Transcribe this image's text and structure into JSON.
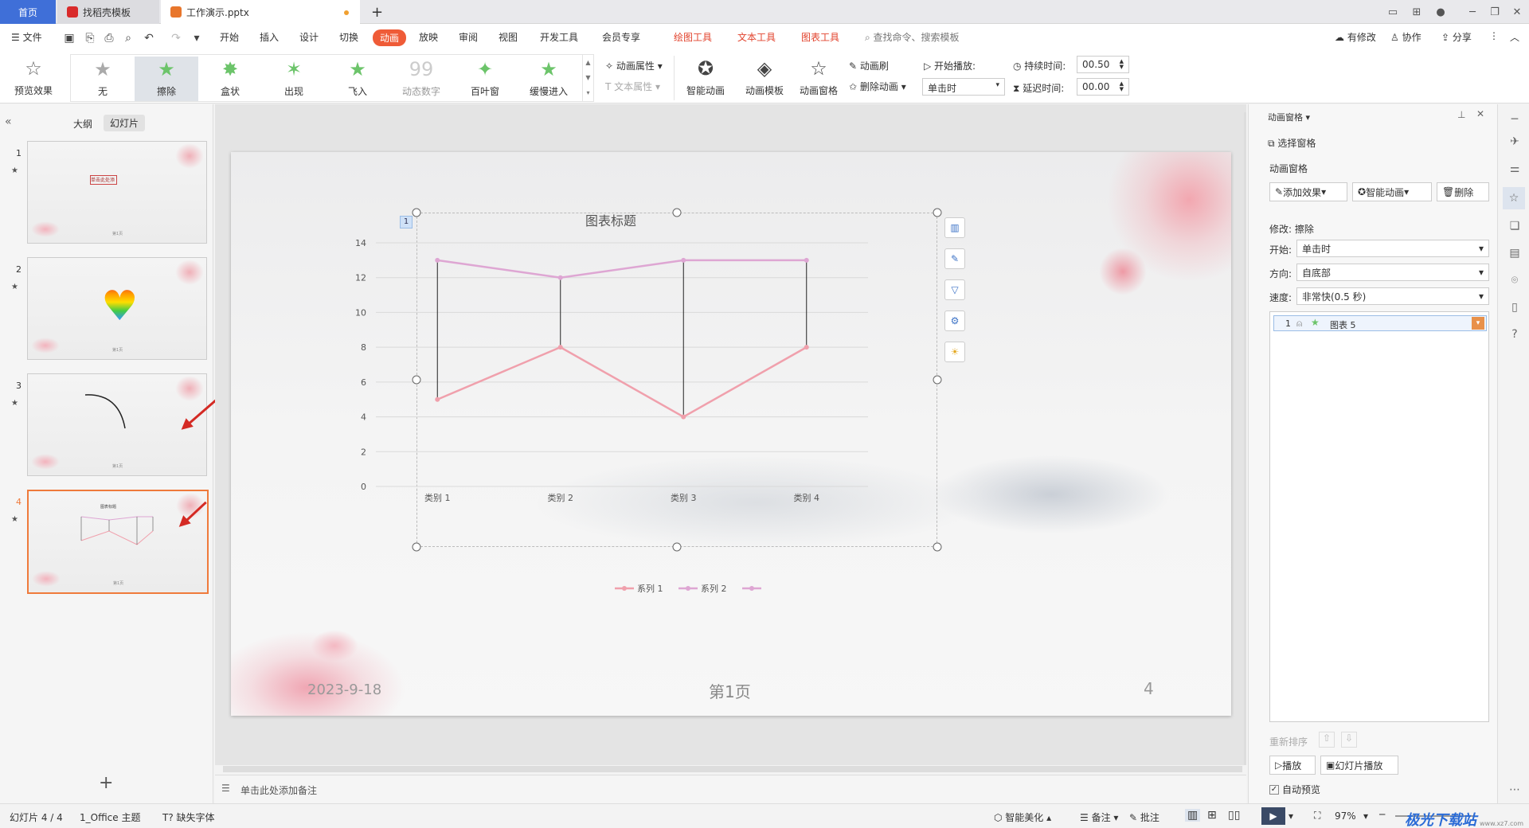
{
  "tabs": {
    "home": "首页",
    "template": "找稻壳模板",
    "doc": "工作演示.pptx",
    "new_tab": "+"
  },
  "menu": {
    "file": "文件",
    "items": [
      "开始",
      "插入",
      "设计",
      "切换",
      "动画",
      "放映",
      "审阅",
      "视图",
      "开发工具",
      "会员专享"
    ],
    "context": [
      "绘图工具",
      "文本工具",
      "图表工具"
    ],
    "search": "查找命令、搜索模板",
    "right": [
      "有修改",
      "协作",
      "分享"
    ]
  },
  "ribbon": {
    "preview": "预览效果",
    "effects": [
      "无",
      "擦除",
      "盒状",
      "出现",
      "飞入",
      "动态数字",
      "百叶窗",
      "缓慢进入"
    ],
    "anim_props": "动画属性",
    "text_props": "文本属性",
    "smart_anim": "智能动画",
    "anim_template": "动画模板",
    "anim_pane": "动画窗格",
    "anim_brush": "动画刷",
    "delete_anim": "删除动画",
    "start_play": "开始播放:",
    "start_value": "单击时",
    "duration_label": "持续时间:",
    "duration_value": "00.50",
    "delay_label": "延迟时间:",
    "delay_value": "00.00"
  },
  "left": {
    "outline": "大纲",
    "slides": "幻灯片",
    "nums": [
      "1",
      "2",
      "3",
      "4"
    ],
    "thumb1_text": "单击此处添加标题",
    "thumb4_title": "图表标题",
    "footer_page": "第1页"
  },
  "chart": {
    "badge": "1",
    "side_icons": [
      "chart-elements-icon",
      "chart-style-icon",
      "chart-filter-icon",
      "settings-icon",
      "bulb-icon"
    ]
  },
  "chart_data": {
    "type": "line",
    "title": "图表标题",
    "categories": [
      "类别 1",
      "类别 2",
      "类别 3",
      "类别 4"
    ],
    "series": [
      {
        "name": "系列 1",
        "values": [
          5,
          8,
          4,
          8
        ],
        "color": "#f0a0ac"
      },
      {
        "name": "系列 2",
        "values": [
          13,
          12,
          13,
          13
        ],
        "color": "#dea6d3"
      },
      {
        "name": "",
        "values": [],
        "color": "#dea6d3"
      }
    ],
    "ylim": [
      0,
      14
    ],
    "yticks": [
      0,
      2,
      4,
      6,
      8,
      10,
      12,
      14
    ],
    "grid": true,
    "legend": "bottom",
    "high_low_lines": true
  },
  "slide": {
    "date": "2023-9-18",
    "page": "第1页",
    "num": "4"
  },
  "notes": "单击此处添加备注",
  "rightpanel": {
    "title": "动画窗格",
    "select_pane": "选择窗格",
    "section": "动画窗格",
    "add_effect": "添加效果",
    "smart_anim": "智能动画",
    "delete": "删除",
    "modify": "修改: 擦除",
    "start_label": "开始:",
    "start_value": "单击时",
    "dir_label": "方向:",
    "dir_value": "自底部",
    "speed_label": "速度:",
    "speed_value": "非常快(0.5 秒)",
    "item_num": "1",
    "item_name": "图表 5",
    "reorder": "重新排序",
    "play": "播放",
    "slideshow": "幻灯片播放",
    "auto_preview": "自动预览"
  },
  "status": {
    "slide": "幻灯片 4 / 4",
    "theme": "1_Office 主题",
    "font": "缺失字体",
    "beautify": "智能美化",
    "notes": "备注",
    "comments": "批注",
    "zoom": "97%",
    "watermark": "极光下载站",
    "watermark_url": "www.xz7.com"
  },
  "colors": {
    "accent": "#ef5b37",
    "home_tab": "#3f6fd8",
    "arrow": "#d42a24",
    "selected_thumb": "#ef7a3b"
  }
}
